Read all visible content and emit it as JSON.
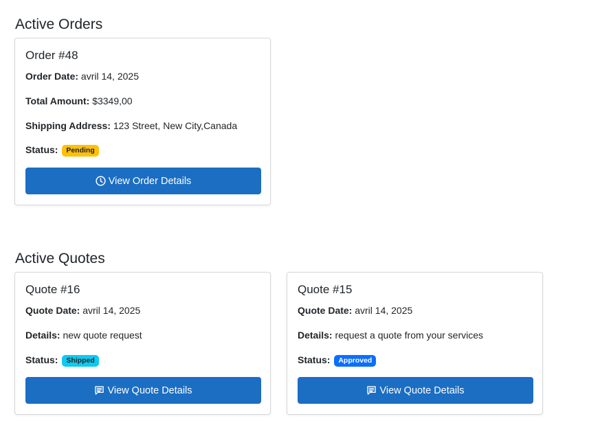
{
  "active_orders": {
    "title": "Active Orders",
    "orders": [
      {
        "title": "Order #48",
        "order_date_label": "Order Date:",
        "order_date": "avril 14, 2025",
        "total_label": "Total Amount:",
        "total": "$3349,00",
        "shipping_label": "Shipping Address:",
        "shipping": "123 Street, New City,Canada",
        "status_label": "Status:",
        "status": "Pending",
        "status_color": "#ffc107",
        "button_label": "View Order Details",
        "button_icon": "clock-icon"
      }
    ]
  },
  "active_quotes": {
    "title": "Active Quotes",
    "quotes": [
      {
        "title": "Quote #16",
        "quote_date_label": "Quote Date:",
        "quote_date": "avril 14, 2025",
        "details_label": "Details:",
        "details": "new quote request",
        "status_label": "Status:",
        "status": "Shipped",
        "status_color": "#0dcaf0",
        "button_label": "View Quote Details",
        "button_icon": "message-icon"
      },
      {
        "title": "Quote #15",
        "quote_date_label": "Quote Date:",
        "quote_date": "avril 14, 2025",
        "details_label": "Details:",
        "details": "request a quote from your services",
        "status_label": "Status:",
        "status": "Approved",
        "status_color": "#0d6efd",
        "button_label": "View Quote Details",
        "button_icon": "message-icon"
      }
    ]
  },
  "colors": {
    "button": "#1b6ec2",
    "card_border": "#d6d8db"
  }
}
